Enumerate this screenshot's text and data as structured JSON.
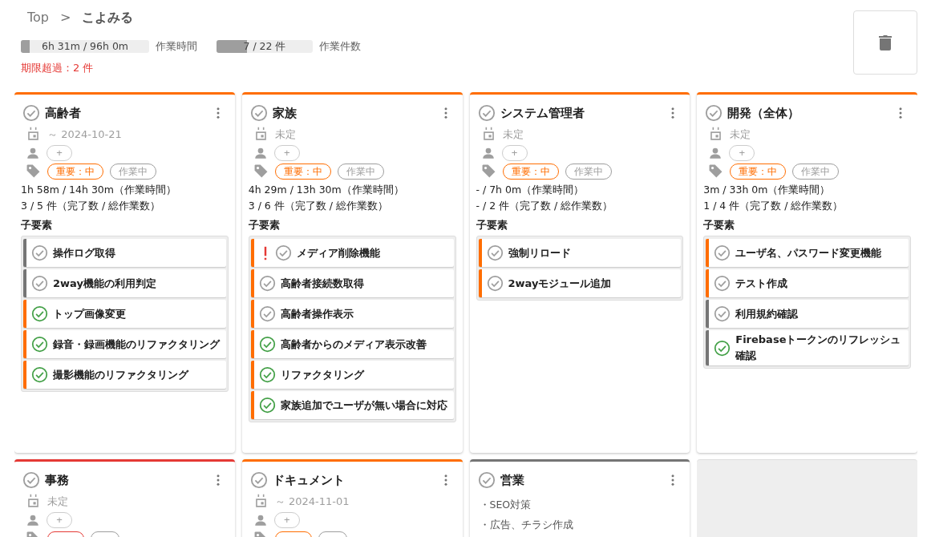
{
  "breadcrumb": {
    "root": "Top",
    "separator": ">",
    "current": "こよみる"
  },
  "summary": {
    "time": {
      "text": "6h 31m / 96h 0m",
      "level": 0.068,
      "label": "作業時間"
    },
    "count": {
      "text": "7 / 22 件",
      "level": 0.318,
      "label": "作業件数"
    },
    "overdue": "期限超過：2 件"
  },
  "cards": [
    {
      "kind": "task",
      "color": "#ff6d00",
      "title": "高齢者",
      "date": "～ 2024-10-21",
      "assignee_add": "+",
      "tags": [
        {
          "label": "重要：中",
          "color": "#ff6d00"
        },
        {
          "label": "作業中",
          "color": "#9e9e9e"
        }
      ],
      "time_stat": "1h 58m / 14h 30m（作業時間）",
      "count_stat": "3 / 5 件（完了数 / 総作業数）",
      "children_label": "子要素",
      "children": [
        {
          "title": "操作ログ取得",
          "done": false,
          "alert": false,
          "color": "#757575"
        },
        {
          "title": "2way機能の利用判定",
          "done": false,
          "alert": false,
          "color": "#757575"
        },
        {
          "title": "トップ画像変更",
          "done": true,
          "alert": false,
          "color": "#ff6d00"
        },
        {
          "title": "録音・録画機能のリファクタリング",
          "done": true,
          "alert": false,
          "color": "#ff6d00"
        },
        {
          "title": "撮影機能のリファクタリング",
          "done": true,
          "alert": false,
          "color": "#ff6d00"
        }
      ]
    },
    {
      "kind": "task",
      "color": "#ff6d00",
      "title": "家族",
      "date": "未定",
      "assignee_add": "+",
      "tags": [
        {
          "label": "重要：中",
          "color": "#ff6d00"
        },
        {
          "label": "作業中",
          "color": "#9e9e9e"
        }
      ],
      "time_stat": "4h 29m / 13h 30m（作業時間）",
      "count_stat": "3 / 6 件（完了数 / 総作業数）",
      "children_label": "子要素",
      "children": [
        {
          "title": "メディア削除機能",
          "done": false,
          "alert": true,
          "color": "#ff6d00"
        },
        {
          "title": "高齢者接続数取得",
          "done": false,
          "alert": false,
          "color": "#ff6d00"
        },
        {
          "title": "高齢者操作表示",
          "done": false,
          "alert": false,
          "color": "#ff6d00"
        },
        {
          "title": "高齢者からのメディア表示改善",
          "done": true,
          "alert": false,
          "color": "#ff6d00"
        },
        {
          "title": "リファクタリング",
          "done": true,
          "alert": false,
          "color": "#ff6d00"
        },
        {
          "title": "家族追加でユーザが無い場合に対応",
          "done": true,
          "alert": false,
          "color": "#ff6d00"
        }
      ]
    },
    {
      "kind": "task",
      "color": "#ff6d00",
      "title": "システム管理者",
      "date": "未定",
      "assignee_add": "+",
      "tags": [
        {
          "label": "重要：中",
          "color": "#ff6d00"
        },
        {
          "label": "作業中",
          "color": "#9e9e9e"
        }
      ],
      "time_stat": "- / 7h 0m（作業時間）",
      "count_stat": "- / 2 件（完了数 / 総作業数）",
      "children_label": "子要素",
      "children": [
        {
          "title": "強制リロード",
          "done": false,
          "alert": false,
          "color": "#ff6d00"
        },
        {
          "title": "2wayモジュール追加",
          "done": false,
          "alert": false,
          "color": "#ff6d00"
        }
      ]
    },
    {
      "kind": "task",
      "color": "#ff6d00",
      "title": "開発（全体）",
      "date": "未定",
      "assignee_add": "+",
      "tags": [
        {
          "label": "重要：中",
          "color": "#ff6d00"
        },
        {
          "label": "作業中",
          "color": "#9e9e9e"
        }
      ],
      "time_stat": "3m / 33h 0m（作業時間）",
      "count_stat": "1 / 4 件（完了数 / 総作業数）",
      "children_label": "子要素",
      "children": [
        {
          "title": "ユーザ名、パスワード変更機能",
          "done": false,
          "alert": false,
          "color": "#ff6d00"
        },
        {
          "title": "テスト作成",
          "done": false,
          "alert": false,
          "color": "#ff6d00"
        },
        {
          "title": "利用規約確認",
          "done": false,
          "alert": false,
          "color": "#757575"
        },
        {
          "title": "Firebaseトークンのリフレッシュ確認",
          "done": true,
          "alert": false,
          "color": "#757575"
        }
      ]
    },
    {
      "kind": "task",
      "color": "#e53935",
      "title": "事務",
      "date": "未定",
      "assignee_add": "+",
      "tags": [
        {
          "color": "#e53935"
        },
        {
          "color": "#9e9e9e"
        }
      ]
    },
    {
      "kind": "task",
      "color": "#ff6d00",
      "title": "ドキュメント",
      "date": "～ 2024-11-01",
      "assignee_add": "+",
      "tags": [
        {
          "color": "#ff6d00"
        },
        {
          "color": "#9e9e9e"
        }
      ]
    },
    {
      "kind": "note",
      "color": "#757575",
      "title": "営業",
      "notes": [
        "・SEO対策",
        "・広告、チラシ作成"
      ]
    },
    {
      "kind": "placeholder"
    }
  ]
}
